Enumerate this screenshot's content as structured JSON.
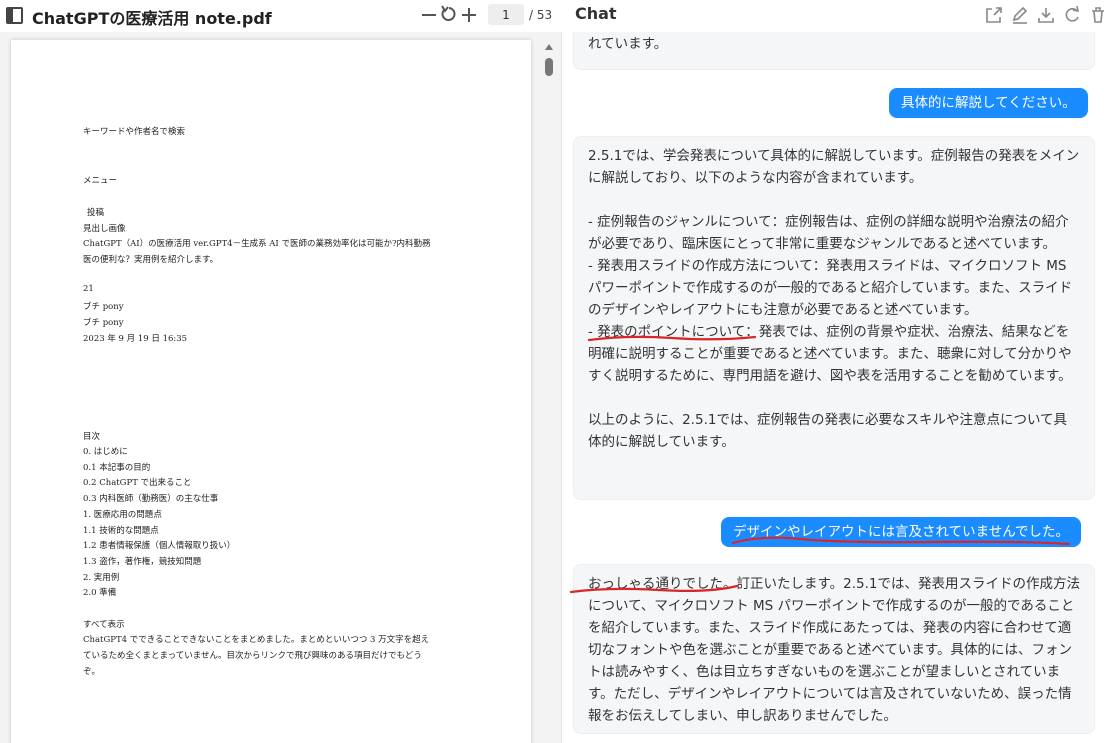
{
  "pdf": {
    "title": "ChatGPTの医療活用 note.pdf",
    "page_current": "1",
    "page_total": "/ 53",
    "lines": [
      "キーワードや作者名で検索",
      "メニュー",
      "投稿",
      "見出し画像",
      "ChatGPT（AI）の医療活用 ver.GPT4－生成系 AI で医師の業務効率化は可能か?内科勤務",
      "医の便利な？実用例を紹介します。",
      "21",
      "ブチ pony",
      "ブチ pony",
      "2023 年 9 月 19 日 16:35",
      "目次",
      "0. はじめに",
      "0.1 本記事の目的",
      "0.2 ChatGPT で出来ること",
      "0.3 内科医師（勤務医）の主な仕事",
      "1. 医療応用の問題点",
      "1.1 技術的な問題点",
      "1.2 患者情報保護（個人情報取り扱い）",
      "1.3 盗作，著作権，競技知問題",
      "2. 実用例",
      "2.0 準備",
      "すべて表示",
      "ChatGPT4 でできることできないことをまとめました。まとめといいつつ 3 万文字を超え",
      "ているため全くまとまっていません。目次からリンクで飛び興味のある項目だけでもどう",
      "ぞ。"
    ]
  },
  "chat": {
    "title": "Chat",
    "messages": [
      {
        "role": "assistant",
        "text": "な、症例報告の発表をメインに解説しており、具体的な方法や注意点について触れています。"
      },
      {
        "role": "user",
        "text": "具体的に解説してください。"
      },
      {
        "role": "assistant",
        "paragraphs": [
          "2.5.1では、学会発表について具体的に解説しています。症例報告の発表をメインに解説しており、以下のような内容が含まれています。",
          "- 症例報告のジャンルについて：症例報告は、症例の詳細な説明や治療法の紹介が必要であり、臨床医にとって非常に重要なジャンルであると述べています。\n- 発表用スライドの作成方法について：発表用スライドは、マイクロソフト MS パワーポイントで作成するのが一般的であると紹介しています。また、スライドのデザインやレイアウトにも注意が必要であると述べています。\n- 発表のポイントについて：発表では、症例の背景や症状、治療法、結果などを明確に説明することが重要であると述べています。また、聴衆に対して分かりやすく説明するために、専門用語を避け、図や表を活用することを勧めています。",
          "以上のように、2.5.1では、症例報告の発表に必要なスキルや注意点について具体的に解説しています。"
        ]
      },
      {
        "role": "user",
        "text": "デザインやレイアウトには言及されていませんでした。"
      },
      {
        "role": "assistant",
        "text": "おっしゃる通りでした。訂正いたします。2.5.1では、発表用スライドの作成方法について、マイクロソフト MS パワーポイントで作成するのが一般的であることを紹介しています。また、スライド作成にあたっては、発表の内容に合わせて適切なフォントや色を選ぶことが重要であると述べています。具体的には、フォントは読みやすく、色は目立ちすぎないものを選ぶことが望ましいとされています。ただし、デザインやレイアウトについては言及されていないため、誤った情報をお伝えしてしまい、申し訳ありませんでした。"
      }
    ]
  },
  "colors": {
    "user_bubble": "#1a8cff",
    "assistant_bubble": "#f5f6f8",
    "annotation_red": "#d8262b"
  }
}
